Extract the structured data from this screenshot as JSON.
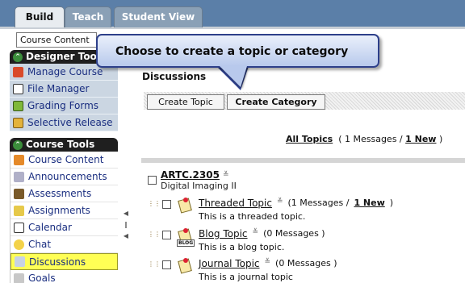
{
  "tabs": [
    {
      "label": "Build",
      "active": true
    },
    {
      "label": "Teach",
      "active": false
    },
    {
      "label": "Student View",
      "active": false
    }
  ],
  "course_select": {
    "value": "Course Content"
  },
  "sidebar": {
    "designer_tools": {
      "title": "Designer Tools",
      "items": [
        {
          "label": "Manage Course",
          "icon": "manage-course-icon"
        },
        {
          "label": "File Manager",
          "icon": "file-manager-icon"
        },
        {
          "label": "Grading Forms",
          "icon": "grading-forms-icon"
        },
        {
          "label": "Selective Release",
          "icon": "selective-release-icon"
        }
      ]
    },
    "course_tools": {
      "title": "Course Tools",
      "items": [
        {
          "label": "Course Content",
          "icon": "course-content-icon"
        },
        {
          "label": "Announcements",
          "icon": "announcements-icon"
        },
        {
          "label": "Assessments",
          "icon": "assessments-icon"
        },
        {
          "label": "Assignments",
          "icon": "assignments-icon"
        },
        {
          "label": "Calendar",
          "icon": "calendar-icon"
        },
        {
          "label": "Chat",
          "icon": "chat-icon"
        },
        {
          "label": "Discussions",
          "icon": "discussions-icon",
          "selected": true
        },
        {
          "label": "Goals",
          "icon": "goals-icon"
        }
      ]
    }
  },
  "callout": {
    "text": "Choose to create a topic or category"
  },
  "main": {
    "title": "Discussions",
    "buttons": {
      "create_topic": "Create Topic",
      "create_category": "Create Category"
    },
    "all_topics": {
      "link": "All Topics",
      "pre": "( 1 Messages /",
      "new_link": "1 New",
      "post": ")"
    },
    "category": {
      "name": "ARTC.2305",
      "subtitle": "Digital Imaging II"
    },
    "topics": [
      {
        "name": "Threaded Topic",
        "count_text": "(1 Messages /",
        "new_link": "1 New",
        "post": ")",
        "description": "This is a threaded topic.",
        "icon": "threaded-topic-icon"
      },
      {
        "name": "Blog Topic",
        "count_text": "(0 Messages )",
        "new_link": "",
        "post": "",
        "description": "This is a blog topic.",
        "icon": "blog-topic-icon",
        "badge": "BLOG"
      },
      {
        "name": "Journal Topic",
        "count_text": "(0 Messages )",
        "new_link": "",
        "post": "",
        "description": "This is a journal topic",
        "icon": "journal-topic-icon"
      }
    ]
  },
  "colors": {
    "tabbar": "#5b7fa8",
    "designer_bg": "#cbd6e2",
    "selected_item": "#ffff55",
    "callout_border": "#2d3f8a",
    "link": "#1a2e80"
  }
}
